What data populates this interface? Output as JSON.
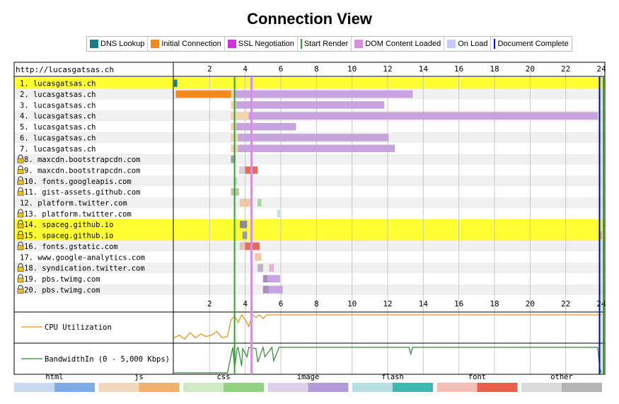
{
  "title": "Connection View",
  "legend": [
    {
      "label": "DNS Lookup",
      "color": "#1f7c83",
      "kind": "box"
    },
    {
      "label": "Initial Connection",
      "color": "#f28b1f",
      "kind": "box"
    },
    {
      "label": "SSL Negotiation",
      "color": "#cc33d9",
      "kind": "box"
    },
    {
      "label": "Start Render",
      "color": "#28a428",
      "kind": "line"
    },
    {
      "label": "DOM Content Loaded",
      "color": "#d88fe4",
      "kind": "box"
    },
    {
      "label": "On Load",
      "color": "#c4c9ff",
      "kind": "box"
    },
    {
      "label": "Document Complete",
      "color": "#0000cc",
      "kind": "line"
    }
  ],
  "chart_data": {
    "type": "waterfall",
    "origin_label": "http://lucasgatsas.ch",
    "x_ticks": [
      2,
      4,
      6,
      8,
      10,
      12,
      14,
      16,
      18,
      20,
      22,
      24
    ],
    "xlim": [
      0,
      24
    ],
    "markers": {
      "start_render": 3.4,
      "dom_content_loaded": 4.35,
      "document_complete": 23.9
    },
    "rows": [
      {
        "label": "1. lucasgatsas.ch",
        "lock": false,
        "highlight": true,
        "segments": [
          {
            "s": 0.0,
            "e": 0.18,
            "c": "#1f7c83"
          }
        ]
      },
      {
        "label": "2. lucasgatsas.ch",
        "lock": false,
        "highlight": false,
        "segments": [
          {
            "s": 0.1,
            "e": 3.2,
            "c": "#f28b1f"
          },
          {
            "s": 3.2,
            "e": 3.45,
            "c": "#f4d3b0"
          },
          {
            "s": 3.45,
            "e": 13.4,
            "c": "#c7a3e0"
          }
        ]
      },
      {
        "label": "3. lucasgatsas.ch",
        "lock": false,
        "highlight": false,
        "segments": [
          {
            "s": 3.2,
            "e": 3.5,
            "c": "#f4d3b0"
          },
          {
            "s": 3.5,
            "e": 11.8,
            "c": "#c7a3e0"
          }
        ]
      },
      {
        "label": "4. lucasgatsas.ch",
        "lock": false,
        "highlight": false,
        "segments": [
          {
            "s": 3.2,
            "e": 4.2,
            "c": "#f4d3b0"
          },
          {
            "s": 4.2,
            "e": 23.8,
            "c": "#c7a3e0"
          }
        ]
      },
      {
        "label": "5. lucasgatsas.ch",
        "lock": false,
        "highlight": false,
        "segments": [
          {
            "s": 3.2,
            "e": 3.5,
            "c": "#f4d3b0"
          },
          {
            "s": 3.5,
            "e": 6.85,
            "c": "#c7a3e0"
          }
        ]
      },
      {
        "label": "6. lucasgatsas.ch",
        "lock": false,
        "highlight": false,
        "segments": [
          {
            "s": 3.2,
            "e": 3.6,
            "c": "#f4d3b0"
          },
          {
            "s": 3.6,
            "e": 12.05,
            "c": "#c7a3e0"
          }
        ]
      },
      {
        "label": "7. lucasgatsas.ch",
        "lock": false,
        "highlight": false,
        "segments": [
          {
            "s": 3.2,
            "e": 3.6,
            "c": "#f4d3b0"
          },
          {
            "s": 3.6,
            "e": 12.4,
            "c": "#c7a3e0"
          }
        ]
      },
      {
        "label": "8. maxcdn.bootstrapcdn.com",
        "lock": true,
        "highlight": false,
        "segments": [
          {
            "s": 3.2,
            "e": 3.45,
            "c": "#9d9da8"
          }
        ]
      },
      {
        "label": "9. maxcdn.bootstrapcdn.com",
        "lock": true,
        "highlight": false,
        "segments": [
          {
            "s": 3.65,
            "e": 4.0,
            "c": "#d9d0d8"
          },
          {
            "s": 4.0,
            "e": 4.7,
            "c": "#e96c54"
          }
        ]
      },
      {
        "label": "10. fonts.googleapis.com",
        "lock": true,
        "highlight": false,
        "segments": [
          {
            "s": 3.4,
            "e": 3.55,
            "c": "#c7dcc0"
          }
        ]
      },
      {
        "label": "11. gist-assets.github.com",
        "lock": true,
        "highlight": false,
        "segments": [
          {
            "s": 3.2,
            "e": 3.65,
            "c": "#b9c9a8"
          }
        ]
      },
      {
        "label": "12. platform.twitter.com",
        "lock": false,
        "highlight": false,
        "segments": [
          {
            "s": 3.7,
            "e": 4.4,
            "c": "#f1c8a3"
          },
          {
            "s": 4.7,
            "e": 4.9,
            "c": "#a9d99a"
          }
        ]
      },
      {
        "label": "13. platform.twitter.com",
        "lock": true,
        "highlight": false,
        "segments": [
          {
            "s": 5.8,
            "e": 5.95,
            "c": "#c9d9f0"
          }
        ]
      },
      {
        "label": "14. spaceg.github.io",
        "lock": true,
        "highlight": true,
        "segments": [
          {
            "s": 3.7,
            "e": 4.1,
            "c": "#8a8a9a"
          }
        ]
      },
      {
        "label": "15. spaceg.github.io",
        "lock": true,
        "highlight": true,
        "segments": [
          {
            "s": 3.85,
            "e": 4.1,
            "c": "#9a9aaa"
          },
          {
            "s": 23.95,
            "e": 24.0,
            "c": "#d5a0a0"
          }
        ]
      },
      {
        "label": "16. fonts.gstatic.com",
        "lock": true,
        "highlight": false,
        "segments": [
          {
            "s": 3.7,
            "e": 4.0,
            "c": "#e8c0bc"
          },
          {
            "s": 4.0,
            "e": 4.8,
            "c": "#e96c54"
          }
        ]
      },
      {
        "label": "17. www.google-analytics.com",
        "lock": false,
        "highlight": false,
        "segments": [
          {
            "s": 4.55,
            "e": 4.9,
            "c": "#f1c8a3"
          }
        ]
      },
      {
        "label": "18. syndication.twitter.com",
        "lock": true,
        "highlight": false,
        "segments": [
          {
            "s": 4.7,
            "e": 5.0,
            "c": "#c0b0c8"
          },
          {
            "s": 5.35,
            "e": 5.6,
            "c": "#e8b0d6"
          }
        ]
      },
      {
        "label": "19. pbs.twimg.com",
        "lock": true,
        "highlight": false,
        "segments": [
          {
            "s": 5.0,
            "e": 5.25,
            "c": "#a98fc0"
          },
          {
            "s": 5.25,
            "e": 5.95,
            "c": "#c7a3e0"
          }
        ]
      },
      {
        "label": "20. pbs.twimg.com",
        "lock": true,
        "highlight": false,
        "segments": [
          {
            "s": 5.0,
            "e": 5.3,
            "c": "#a98fc0"
          },
          {
            "s": 5.3,
            "e": 6.1,
            "c": "#c7a3e0"
          }
        ]
      }
    ],
    "cpu": {
      "label": "CPU Utilization",
      "color": "#f2941f",
      "t": [
        0,
        0.3,
        0.6,
        0.9,
        1.2,
        1.5,
        1.8,
        2.1,
        2.4,
        2.7,
        3.0,
        3.2,
        3.4,
        3.6,
        3.8,
        4.0,
        4.2,
        4.4,
        4.6,
        4.8,
        5.0,
        5.2,
        5.5,
        6.0,
        24.0
      ],
      "v": [
        10,
        20,
        5,
        30,
        10,
        25,
        15,
        20,
        35,
        10,
        15,
        80,
        95,
        70,
        100,
        80,
        55,
        100,
        90,
        100,
        85,
        100,
        100,
        100,
        100
      ]
    },
    "bandwidth": {
      "label": "BandwidthIn (0 - 5,000 Kbps)",
      "color": "#2e8b2e",
      "t": [
        0,
        3.0,
        3.3,
        3.4,
        3.55,
        3.6,
        3.8,
        3.85,
        4.1,
        4.2,
        4.6,
        4.7,
        5.0,
        5.1,
        5.5,
        5.6,
        5.9,
        6.2,
        8.0,
        10.0,
        13.2,
        13.3,
        13.4,
        16.0,
        20.0,
        23.8,
        23.9,
        24.0
      ],
      "v": [
        0,
        0,
        95,
        20,
        90,
        95,
        25,
        90,
        60,
        95,
        90,
        40,
        95,
        60,
        95,
        45,
        95,
        95,
        95,
        95,
        95,
        70,
        95,
        95,
        95,
        95,
        20,
        0
      ]
    }
  },
  "type_legend": [
    {
      "label": "html",
      "light": "#c9d9f0",
      "dark": "#7eaae6"
    },
    {
      "label": "js",
      "light": "#f1d8bd",
      "dark": "#f0b070"
    },
    {
      "label": "css",
      "light": "#cfe8c5",
      "dark": "#93d183"
    },
    {
      "label": "image",
      "light": "#ddd0ea",
      "dark": "#b39ad8"
    },
    {
      "label": "flash",
      "light": "#b5dfe0",
      "dark": "#3fb6b2"
    },
    {
      "label": "font",
      "light": "#f0c0b5",
      "dark": "#e8604c"
    },
    {
      "label": "other",
      "light": "#dadada",
      "dark": "#b4b4b4"
    }
  ]
}
